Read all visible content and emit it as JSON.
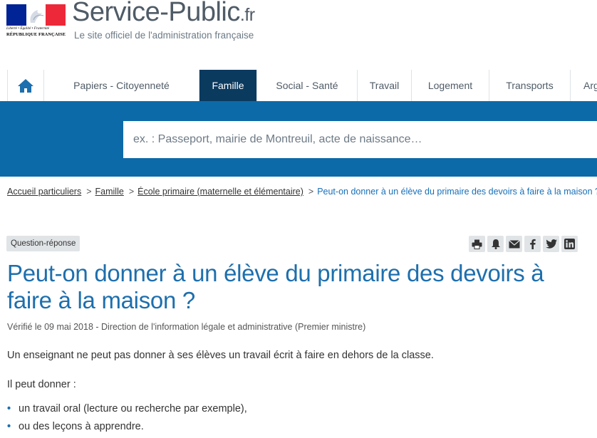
{
  "header": {
    "motto": "Liberté • Égalité • Fraternité",
    "republic": "RÉPUBLIQUE FRANÇAISE",
    "site_name": "Service-Public",
    "site_tld": ".fr",
    "subtitle": "Le site officiel de l'administration française",
    "flag_colors": [
      "#002395",
      "#ffffff",
      "#ed2939"
    ]
  },
  "nav": {
    "home_icon": "home-icon",
    "items": [
      {
        "label": "Papiers - Citoyenneté",
        "active": false
      },
      {
        "label": "Famille",
        "active": true
      },
      {
        "label": "Social - Santé",
        "active": false
      },
      {
        "label": "Travail",
        "active": false
      },
      {
        "label": "Logement",
        "active": false
      },
      {
        "label": "Transports",
        "active": false
      },
      {
        "label": "Argent",
        "active": false
      }
    ],
    "active_color": "#0b3a5f"
  },
  "search": {
    "placeholder": "ex. : Passeport, mairie de Montreuil, acte de naissance…",
    "band_color": "#0d6aa8"
  },
  "breadcrumb": {
    "items": [
      "Accueil particuliers",
      "Famille",
      "École primaire (maternelle et élémentaire)"
    ],
    "current": "Peut-on donner à un élève du primaire des devoirs à faire à la maison ?",
    "separator": ">"
  },
  "content": {
    "badge": "Question-réponse",
    "share_icons": [
      "print-icon",
      "bell-icon",
      "mail-icon",
      "facebook-icon",
      "twitter-icon",
      "linkedin-icon"
    ],
    "title": "Peut-on donner à un élève du primaire des devoirs à faire à la maison ?",
    "verified": "Vérifié le 09 mai 2018 - Direction de l'information légale et administrative (Premier ministre)",
    "paragraph1": "Un enseignant ne peut pas donner à ses élèves un travail écrit à faire en dehors de la classe.",
    "paragraph2": "Il peut donner  :",
    "bullets": [
      "un travail oral (lecture ou recherche par exemple),",
      "ou des leçons à apprendre."
    ],
    "title_color": "#1d6fad"
  }
}
